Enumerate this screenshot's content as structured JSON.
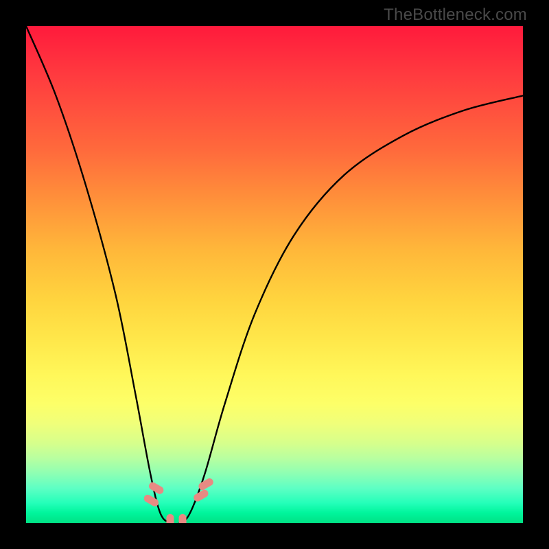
{
  "watermark": "TheBottleneck.com",
  "chart_data": {
    "type": "line",
    "title": "",
    "xlabel": "",
    "ylabel": "",
    "xlim": [
      0,
      1
    ],
    "ylim": [
      0,
      1
    ],
    "series": [
      {
        "name": "bottleneck-curve",
        "x": [
          0.0,
          0.06,
          0.12,
          0.18,
          0.22,
          0.25,
          0.27,
          0.29,
          0.31,
          0.33,
          0.36,
          0.4,
          0.46,
          0.54,
          0.64,
          0.76,
          0.88,
          1.0
        ],
        "values": [
          1.0,
          0.86,
          0.68,
          0.46,
          0.26,
          0.1,
          0.02,
          0.0,
          0.0,
          0.02,
          0.1,
          0.24,
          0.42,
          0.58,
          0.7,
          0.78,
          0.83,
          0.86
        ]
      }
    ],
    "markers": [
      {
        "x": 0.252,
        "y": 0.045,
        "rotation": -60
      },
      {
        "x": 0.262,
        "y": 0.07,
        "rotation": -60
      },
      {
        "x": 0.29,
        "y": 0.002,
        "rotation": 0
      },
      {
        "x": 0.315,
        "y": 0.002,
        "rotation": 0
      },
      {
        "x": 0.352,
        "y": 0.055,
        "rotation": 60
      },
      {
        "x": 0.362,
        "y": 0.078,
        "rotation": 60
      }
    ],
    "background_gradient": {
      "top": "#ff1a3c",
      "mid": "#fff254",
      "bottom": "#00e285"
    }
  }
}
